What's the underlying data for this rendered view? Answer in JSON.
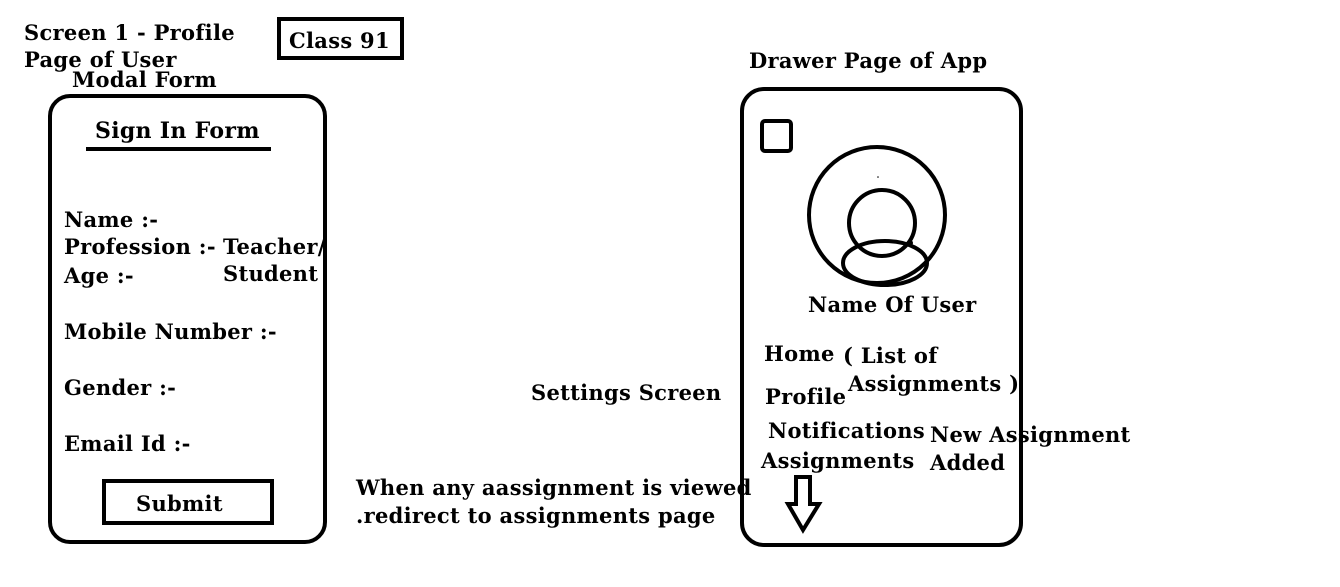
{
  "header": {
    "screen_title_line1": "Screen 1 - Profile",
    "screen_title_line2": "Page of User",
    "class_label": "Class 91"
  },
  "modal": {
    "caption": "Modal Form",
    "form_title": "Sign In Form",
    "fields": {
      "name": "Name :-",
      "profession": "Profession :-",
      "profession_value_1": "Teacher/",
      "profession_value_2": "Student",
      "age": "Age :-",
      "mobile": "Mobile Number :-",
      "gender": "Gender :-",
      "email": "Email Id :-"
    },
    "submit_label": "Submit"
  },
  "drawer": {
    "caption": "Drawer Page of App",
    "user_name": "Name Of User",
    "menu": {
      "home": "Home",
      "home_note_1": "( List of",
      "home_note_2": "Assignments )",
      "profile": "Profile",
      "notifications": "Notifications",
      "assignments": "Assignments"
    },
    "notification_note_1": "New Assignment",
    "notification_note_2": "Added",
    "avatar_icon": "user-avatar-icon",
    "checkbox_icon": "square-icon",
    "arrow_icon": "down-arrow-icon"
  },
  "annotations": {
    "settings": "Settings Screen",
    "redirect_line1": "When any aassignment is viewed",
    "redirect_line2": ".redirect to assignments page"
  }
}
